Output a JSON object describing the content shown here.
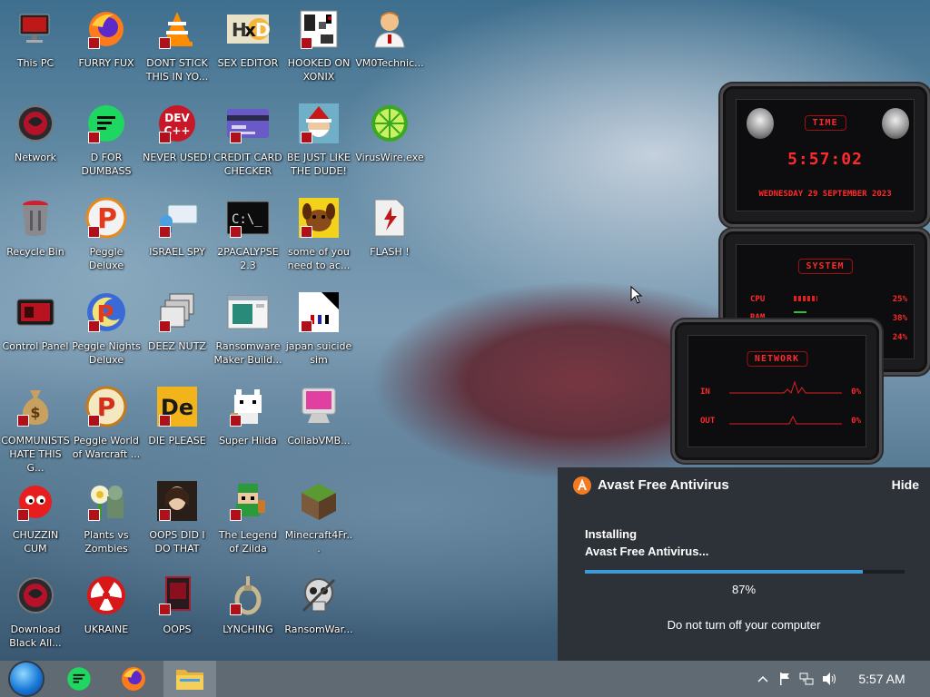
{
  "desktop": {
    "icons": [
      {
        "label": "This PC",
        "icon": "computer-icon"
      },
      {
        "label": "FURRY FUX",
        "icon": "firefox-icon"
      },
      {
        "label": "DONT STICK THIS IN YO...",
        "icon": "vlc-icon"
      },
      {
        "label": "SEX EDITOR",
        "icon": "hxd-icon"
      },
      {
        "label": "HOOKED ON XONIX",
        "icon": "xonix-icon"
      },
      {
        "label": "VM0Technic...",
        "icon": "technician-icon"
      },
      {
        "label": "Network",
        "icon": "network-icon"
      },
      {
        "label": "D FOR DUMBASS",
        "icon": "discord-icon"
      },
      {
        "label": "NEVER USED!",
        "icon": "devcpp-icon"
      },
      {
        "label": "CREDIT CARD CHECKER",
        "icon": "credit-card-icon"
      },
      {
        "label": "BE JUST LIKE THE DUDE!",
        "icon": "santa-icon"
      },
      {
        "label": "VirusWire.exe",
        "icon": "limewire-icon"
      },
      {
        "label": "Recycle Bin",
        "icon": "recycle-bin-icon"
      },
      {
        "label": "Peggle Deluxe",
        "icon": "peggle-icon"
      },
      {
        "label": "ISRAEL SPY",
        "icon": "spy-icon"
      },
      {
        "label": "2PACALYPSE 2.3",
        "icon": "terminal-icon"
      },
      {
        "label": "some of you need to ac...",
        "icon": "dog-icon"
      },
      {
        "label": "FLASH !",
        "icon": "flash-icon"
      },
      {
        "label": "Control Panel",
        "icon": "control-panel-icon"
      },
      {
        "label": "Peggle Nights Deluxe",
        "icon": "peggle-nights-icon"
      },
      {
        "label": "DEEZ NUTZ",
        "icon": "windows-stack-icon"
      },
      {
        "label": "Ransomware Maker Build...",
        "icon": "ransomware-maker-icon"
      },
      {
        "label": "japan suicide sim",
        "icon": "japan-sim-icon"
      },
      {
        "label": "COMMUNISTS HATE THIS G...",
        "icon": "money-bag-icon"
      },
      {
        "label": "Peggle World of Warcraft ...",
        "icon": "peggle-wow-icon"
      },
      {
        "label": "DIE PLEASE",
        "icon": "de-icon"
      },
      {
        "label": "Super Hilda",
        "icon": "pixel-cat-icon"
      },
      {
        "label": "CollabVMB...",
        "icon": "imac-icon"
      },
      {
        "label": "CHUZZIN CUM",
        "icon": "chuzzle-icon"
      },
      {
        "label": "Plants vs Zombies",
        "icon": "pvz-icon"
      },
      {
        "label": "OOPS DID I DO THAT",
        "icon": "portrait-icon"
      },
      {
        "label": "The Legend of Zilda",
        "icon": "zelda-icon"
      },
      {
        "label": "Minecraft4Fr...",
        "icon": "minecraft-icon"
      },
      {
        "label": "Download Black All...",
        "icon": "alien-orb-icon"
      },
      {
        "label": "UKRAINE",
        "icon": "radiation-icon"
      },
      {
        "label": "OOPS",
        "icon": "oops-icon"
      },
      {
        "label": "LYNCHING",
        "icon": "noose-icon"
      },
      {
        "label": "RansomWar...",
        "icon": "skull-icon"
      }
    ]
  },
  "gadgets": {
    "time": {
      "title": "TIME",
      "clock": "5:57:02",
      "date": "WEDNESDAY 29 SEPTEMBER 2023"
    },
    "system": {
      "title": "SYSTEM",
      "cpu_label": "CPU",
      "ram_label": "RAM",
      "cpu_value": "25%",
      "ram_value": "38%",
      "extra_value": "24%"
    },
    "network": {
      "title": "NETWORK",
      "in_label": "IN",
      "out_label": "OUT",
      "in_value": "0%",
      "out_value": "0%"
    }
  },
  "notification": {
    "app_name": "Avast Free Antivirus",
    "hide_label": "Hide",
    "status_line1": "Installing",
    "status_line2": "Avast Free Antivirus...",
    "progress": 0.87,
    "progress_text": "87%",
    "warning": "Do not turn off your computer",
    "accent": "#3f9ad8",
    "brand_color": "#f47b20"
  },
  "taskbar": {
    "start_icon": "start-orb-icon",
    "pinned": [
      "discord-icon",
      "firefox-icon",
      "file-explorer-icon"
    ],
    "tray": [
      "chevron-up-icon",
      "flag-icon",
      "network-icon",
      "volume-icon"
    ],
    "clock": "5:57 AM"
  }
}
